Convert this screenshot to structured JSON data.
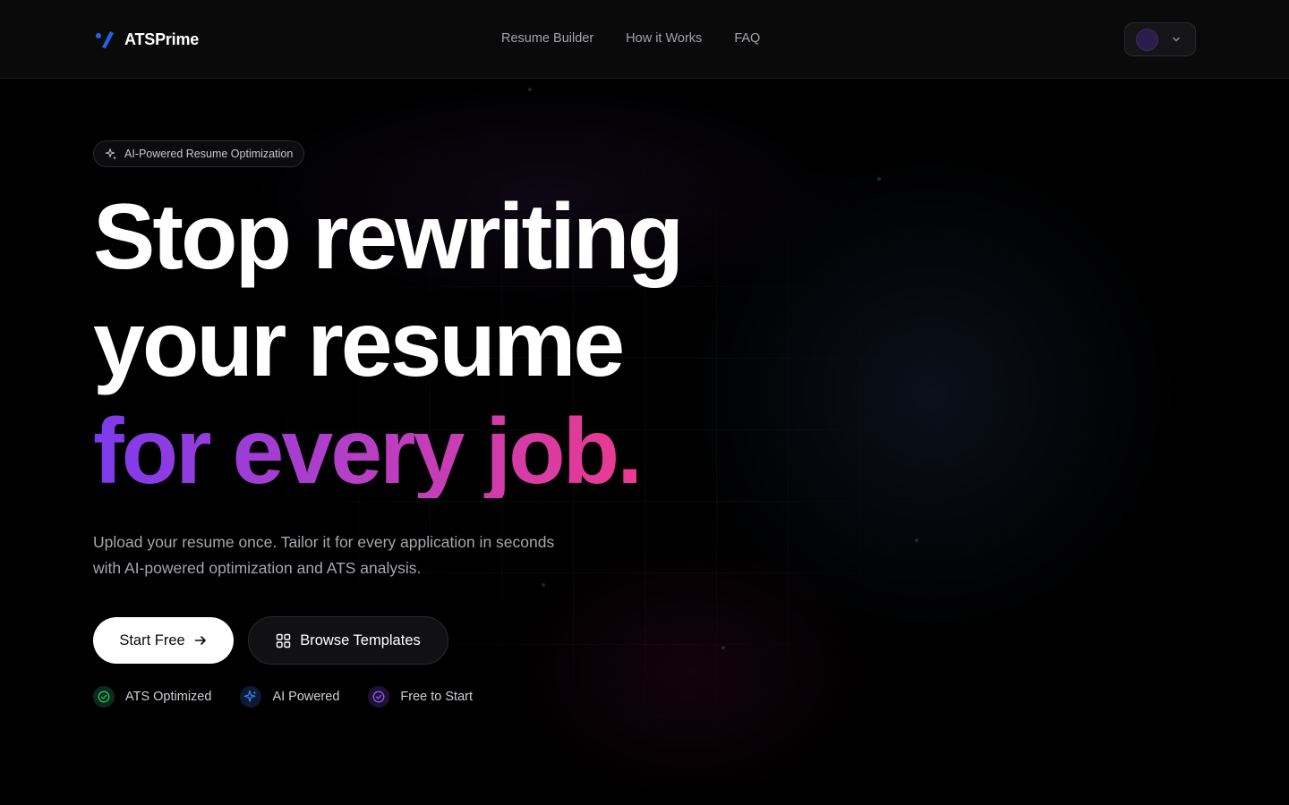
{
  "header": {
    "brand": "ATSPrime",
    "nav": [
      "Resume Builder",
      "How it Works",
      "FAQ"
    ]
  },
  "hero": {
    "badge": "AI-Powered Resume Optimization",
    "headline_line1": "Stop rewriting",
    "headline_line2": "your resume",
    "headline_line3": "for every job.",
    "subheading": "Upload your resume once. Tailor it for every application in seconds with AI-powered optimization and ATS analysis.",
    "primary_cta": "Start Free",
    "secondary_cta": "Browse Templates",
    "features": [
      {
        "label": "ATS Optimized",
        "icon": "check-circle-icon",
        "color": "#22c55e"
      },
      {
        "label": "AI Powered",
        "icon": "sparkle-icon",
        "color": "#3b82f6"
      },
      {
        "label": "Free to Start",
        "icon": "check-circle-icon",
        "color": "#8b5cf6"
      }
    ]
  },
  "colors": {
    "background": "#000000",
    "accent_gradient_start": "#7c3aed",
    "accent_gradient_end": "#ec3a8f",
    "brand_mark": "#2563eb"
  }
}
